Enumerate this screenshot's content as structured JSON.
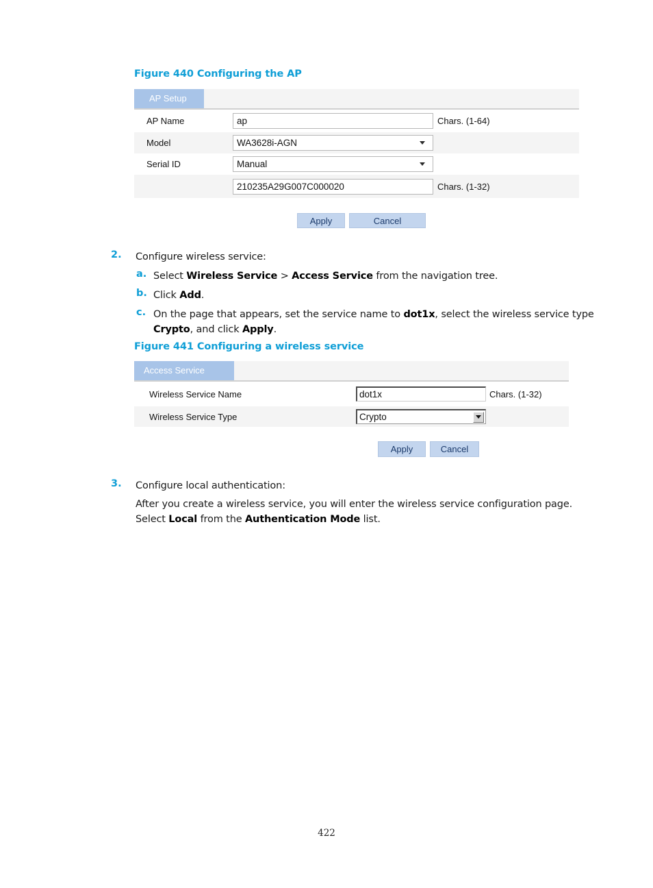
{
  "page": {
    "number": "422"
  },
  "figure440": {
    "caption": "Figure 440 Configuring the AP",
    "tab_label": "AP Setup",
    "rows": [
      {
        "label": "AP Name",
        "value": "ap",
        "hint": "Chars. (1-64)",
        "control": "text"
      },
      {
        "label": "Model",
        "value": "WA3628i-AGN",
        "hint": "",
        "control": "select"
      },
      {
        "label": "Serial ID",
        "value": "Manual",
        "hint": "",
        "control": "select"
      },
      {
        "label": "",
        "value": "210235A29G007C000020",
        "hint": "Chars. (1-32)",
        "control": "text"
      }
    ],
    "apply_label": "Apply",
    "cancel_label": "Cancel"
  },
  "step2": {
    "marker": "2.",
    "title": "Configure wireless service:",
    "items": [
      {
        "marker": "a.",
        "segments": [
          {
            "t": "Select ",
            "b": false
          },
          {
            "t": "Wireless Service",
            "b": true
          },
          {
            "t": " > ",
            "b": false
          },
          {
            "t": "Access Service",
            "b": true
          },
          {
            "t": " from the navigation tree.",
            "b": false
          }
        ]
      },
      {
        "marker": "b.",
        "segments": [
          {
            "t": "Click ",
            "b": false
          },
          {
            "t": "Add",
            "b": true
          },
          {
            "t": ".",
            "b": false
          }
        ]
      },
      {
        "marker": "c.",
        "segments": [
          {
            "t": "On the page that appears, set the service name to ",
            "b": false
          },
          {
            "t": "dot1x",
            "b": true
          },
          {
            "t": ", select the wireless service type ",
            "b": false
          },
          {
            "t": "Crypto",
            "b": true
          },
          {
            "t": ", and click ",
            "b": false
          },
          {
            "t": "Apply",
            "b": true
          },
          {
            "t": ".",
            "b": false
          }
        ]
      }
    ]
  },
  "figure441": {
    "caption": "Figure 441 Configuring a wireless service",
    "tab_label": "Access Service",
    "rows": [
      {
        "label": "Wireless Service Name",
        "value": "dot1x",
        "hint": "Chars. (1-32)",
        "control": "text"
      },
      {
        "label": "Wireless Service Type",
        "value": "Crypto",
        "hint": "",
        "control": "select"
      }
    ],
    "apply_label": "Apply",
    "cancel_label": "Cancel"
  },
  "step3": {
    "marker": "3.",
    "title": "Configure local authentication:",
    "body_segments": [
      {
        "t": "After you create a wireless service, you will enter the wireless service configuration page. Select ",
        "b": false
      },
      {
        "t": "Local",
        "b": true
      },
      {
        "t": " from the ",
        "b": false
      },
      {
        "t": "Authentication Mode",
        "b": true
      },
      {
        "t": " list.",
        "b": false
      }
    ]
  },
  "colors": {
    "accent": "#0e9ed6",
    "tab_bg": "#a8c4e8",
    "row_shade": "#f4f4f4",
    "button_bg": "#c3d5ee",
    "button_text": "#1b3a6b"
  }
}
